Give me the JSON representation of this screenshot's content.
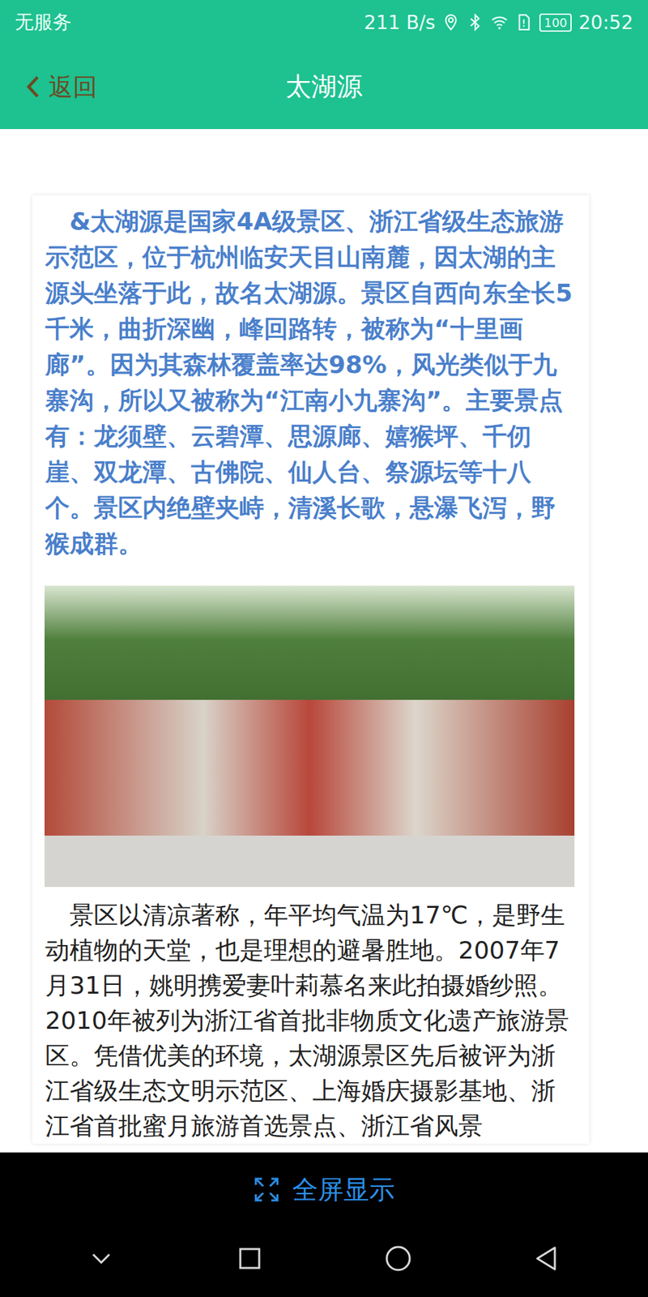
{
  "status_bar": {
    "carrier": "无服务",
    "speed": "211 B/s",
    "battery": "100",
    "time": "20:52"
  },
  "nav": {
    "back": "返回",
    "title": "太湖源"
  },
  "article": {
    "intro": "&太湖源是国家4A级景区、浙江省级生态旅游示范区，位于杭州临安天目山南麓，因太湖的主源头坐落于此，故名太湖源。景区自西向东全长5千米，曲折深幽，峰回路转，被称为“十里画廊”。因为其森林覆盖率达98%，风光类似于九寨沟，所以又被称为“江南小九寨沟”。主要景点有：龙须壁、云碧潭、思源廊、嬉猴坪、千仞崖、双龙潭、古佛院、仙人台、祭源坛等十八个。景区内绝壁夹峙，清溪长歌，悬瀑飞泻，野猴成群。",
    "body": "景区以清凉著称，年平均气温为17℃，是野生动植物的天堂，也是理想的避暑胜地。2007年7月31日，姚明携爱妻叶莉慕名来此拍摄婚纱照。2010年被列为浙江省首批非物质文化遗产旅游景区。凭借优美的环境，太湖源景区先后被评为浙江省级生态文明示范区、上海婚庆摄影基地、浙江省首批蜜月旅游首选景点、浙江省风景"
  },
  "bottom_bar": {
    "fullscreen": "全屏显示"
  }
}
